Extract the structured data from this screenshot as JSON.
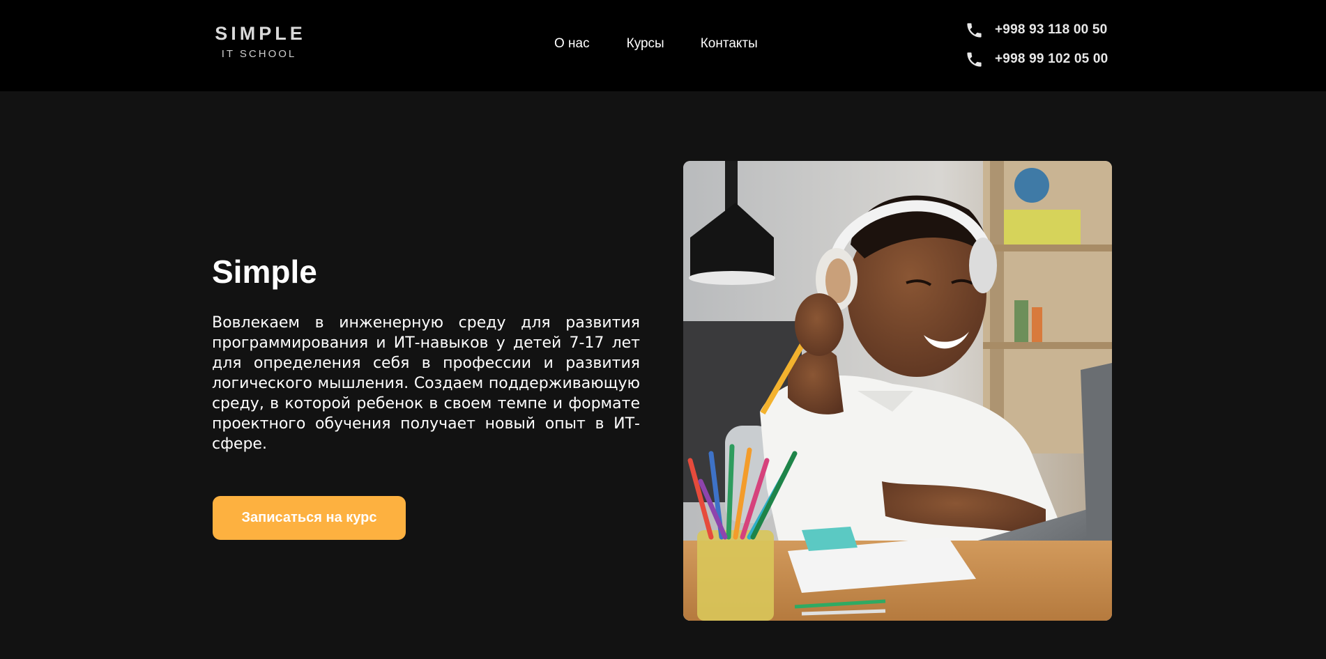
{
  "header": {
    "logo": {
      "main": "SIMPLE",
      "sub": "IT SCHOOL"
    },
    "nav": [
      {
        "label": "О нас"
      },
      {
        "label": "Курсы"
      },
      {
        "label": "Контакты"
      }
    ],
    "phones": [
      {
        "number": "+998 93 118 00 50",
        "icon": "phone-icon"
      },
      {
        "number": "+998 99 102 05 00",
        "icon": "phone-icon"
      }
    ]
  },
  "hero": {
    "title": "Simple",
    "description": "Вовлекаем в инженерную среду для развития программирования и ИТ-навыков у детей 7-17 лет для определения себя в профессии и развития логического мышления. Создаем поддерживающую среду, в которой ребенок в своем темпе и формате проектного обучения получает новый опыт в ИТ-сфере.",
    "cta_label": "Записаться на курс",
    "image": "boy-with-headphones-photo"
  },
  "colors": {
    "header_bg": "#000000",
    "page_bg": "#121212",
    "accent": "#fdb140",
    "text": "#ffffff"
  }
}
